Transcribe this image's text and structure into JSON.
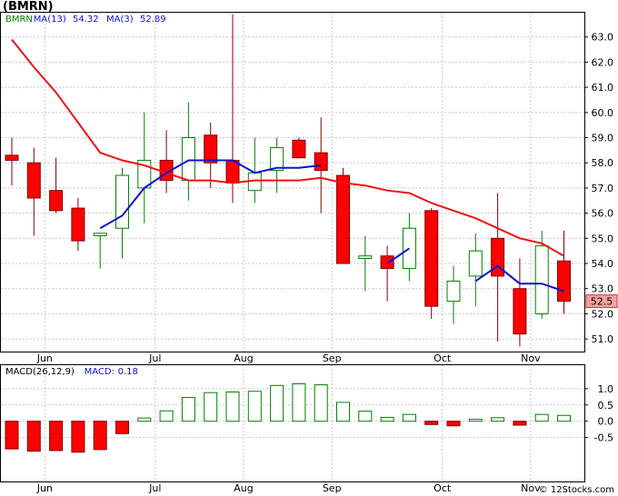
{
  "title": "(BMRN)",
  "watermark": "© 12Stocks.com",
  "colors": {
    "up_candle": "#008000",
    "down_candle": "#ff0000",
    "ma13": "#ee1111",
    "ma3": "#1010cc",
    "grid": "#c8c8c8",
    "last_price_box": "#f4a0a0"
  },
  "chart_data": [
    {
      "type": "candlestick",
      "title": "",
      "legend": [
        {
          "text": "BMRN",
          "color": "#008000"
        },
        {
          "text": "MA(13)",
          "color": "#1010cc"
        },
        {
          "text": "54.32",
          "color": "#1010cc"
        },
        {
          "text": "MA(3)",
          "color": "#1010cc"
        },
        {
          "text": "52.89",
          "color": "#1010cc"
        }
      ],
      "ylim": [
        50.5,
        64.0
      ],
      "y_ticks": [
        51.0,
        52.0,
        53.0,
        54.0,
        55.0,
        56.0,
        57.0,
        58.0,
        59.0,
        60.0,
        61.0,
        62.0,
        63.0
      ],
      "y_tick_labels": [
        "51.0",
        "52.0",
        "53.0",
        "54.0",
        "55.0",
        "56.0",
        "57.0",
        "58.0",
        "59.0",
        "60.0",
        "61.0",
        "62.0",
        "63.0"
      ],
      "x_labels": [
        {
          "label": "Jun",
          "index": 1
        },
        {
          "label": "Jul",
          "index": 6
        },
        {
          "label": "Aug",
          "index": 10
        },
        {
          "label": "Sep",
          "index": 14
        },
        {
          "label": "Oct",
          "index": 19
        },
        {
          "label": "Nov",
          "index": 23
        }
      ],
      "last_price_label": "52.5",
      "last_price": 52.5,
      "candles": [
        {
          "o": 58.3,
          "h": 59.0,
          "l": 57.1,
          "c": 58.1
        },
        {
          "o": 58.0,
          "h": 58.6,
          "l": 55.1,
          "c": 56.6
        },
        {
          "o": 56.9,
          "h": 58.2,
          "l": 56.0,
          "c": 56.1
        },
        {
          "o": 56.2,
          "h": 56.6,
          "l": 54.5,
          "c": 54.9
        },
        {
          "o": 55.1,
          "h": 55.2,
          "l": 53.8,
          "c": 55.2
        },
        {
          "o": 55.4,
          "h": 57.8,
          "l": 54.2,
          "c": 57.5
        },
        {
          "o": 57.0,
          "h": 60.0,
          "l": 55.6,
          "c": 58.1
        },
        {
          "o": 58.1,
          "h": 59.3,
          "l": 56.8,
          "c": 57.3
        },
        {
          "o": 57.3,
          "h": 60.4,
          "l": 56.5,
          "c": 59.0
        },
        {
          "o": 59.1,
          "h": 59.6,
          "l": 57.0,
          "c": 58.0
        },
        {
          "o": 58.1,
          "h": 63.9,
          "l": 56.4,
          "c": 57.2
        },
        {
          "o": 56.9,
          "h": 59.0,
          "l": 56.4,
          "c": 57.6
        },
        {
          "o": 57.7,
          "h": 59.0,
          "l": 56.8,
          "c": 58.6
        },
        {
          "o": 58.9,
          "h": 59.0,
          "l": 58.2,
          "c": 58.2
        },
        {
          "o": 58.4,
          "h": 59.8,
          "l": 56.0,
          "c": 57.7
        },
        {
          "o": 57.5,
          "h": 57.8,
          "l": 54.0,
          "c": 54.0
        },
        {
          "o": 54.2,
          "h": 55.1,
          "l": 52.9,
          "c": 54.3
        },
        {
          "o": 54.3,
          "h": 54.7,
          "l": 52.5,
          "c": 53.8
        },
        {
          "o": 53.8,
          "h": 56.0,
          "l": 53.3,
          "c": 55.4
        },
        {
          "o": 56.1,
          "h": 56.2,
          "l": 51.8,
          "c": 52.3
        },
        {
          "o": 52.5,
          "h": 53.9,
          "l": 51.6,
          "c": 53.3
        },
        {
          "o": 53.5,
          "h": 55.2,
          "l": 52.3,
          "c": 54.5
        },
        {
          "o": 55.0,
          "h": 56.8,
          "l": 50.9,
          "c": 53.5
        },
        {
          "o": 53.0,
          "h": 54.2,
          "l": 50.7,
          "c": 51.2
        },
        {
          "o": 52.0,
          "h": 55.3,
          "l": 51.8,
          "c": 54.7
        },
        {
          "o": 54.1,
          "h": 55.3,
          "l": 52.0,
          "c": 52.5
        }
      ],
      "series": [
        {
          "name": "MA(13)",
          "color": "#ee1111",
          "values": [
            62.9,
            61.8,
            60.8,
            59.6,
            58.4,
            58.1,
            57.9,
            57.6,
            57.3,
            57.3,
            57.2,
            57.3,
            57.3,
            57.3,
            57.4,
            57.2,
            57.1,
            56.9,
            56.8,
            56.4,
            56.1,
            55.8,
            55.4,
            55.0,
            54.8,
            54.3
          ]
        },
        {
          "name": "MA(3)",
          "color": "#1010cc",
          "values": [
            null,
            null,
            null,
            null,
            55.4,
            55.9,
            57.0,
            57.6,
            58.1,
            58.1,
            58.1,
            57.6,
            57.8,
            57.8,
            57.9,
            null,
            null,
            54.0,
            54.6,
            null,
            null,
            53.3,
            53.9,
            53.2,
            53.2,
            52.9
          ]
        }
      ]
    },
    {
      "type": "bar",
      "title": "",
      "legend": [
        {
          "text": "MACD(26,12,9)",
          "color": "#000000"
        },
        {
          "text": "MACD:",
          "color": "#1010cc"
        },
        {
          "text": "0.18",
          "color": "#1010cc"
        }
      ],
      "ylim": [
        -1.85,
        1.75
      ],
      "y_ticks": [
        1.0,
        0.5,
        0.0,
        -0.5
      ],
      "y_tick_labels": [
        "1.0",
        "0.5",
        "0.0",
        "-0.5"
      ],
      "x_labels": [
        {
          "label": "Jun",
          "index": 1
        },
        {
          "label": "Jul",
          "index": 6
        },
        {
          "label": "Aug",
          "index": 10
        },
        {
          "label": "Sep",
          "index": 14
        },
        {
          "label": "Oct",
          "index": 19
        },
        {
          "label": "Nov",
          "index": 23
        }
      ],
      "values": [
        -0.85,
        -0.92,
        -0.9,
        -0.95,
        -0.87,
        -0.38,
        0.1,
        0.32,
        0.73,
        0.88,
        0.9,
        0.92,
        1.1,
        1.15,
        1.12,
        0.58,
        0.31,
        0.12,
        0.21,
        -0.1,
        -0.14,
        0.06,
        0.11,
        -0.12,
        0.21,
        0.18
      ]
    }
  ]
}
